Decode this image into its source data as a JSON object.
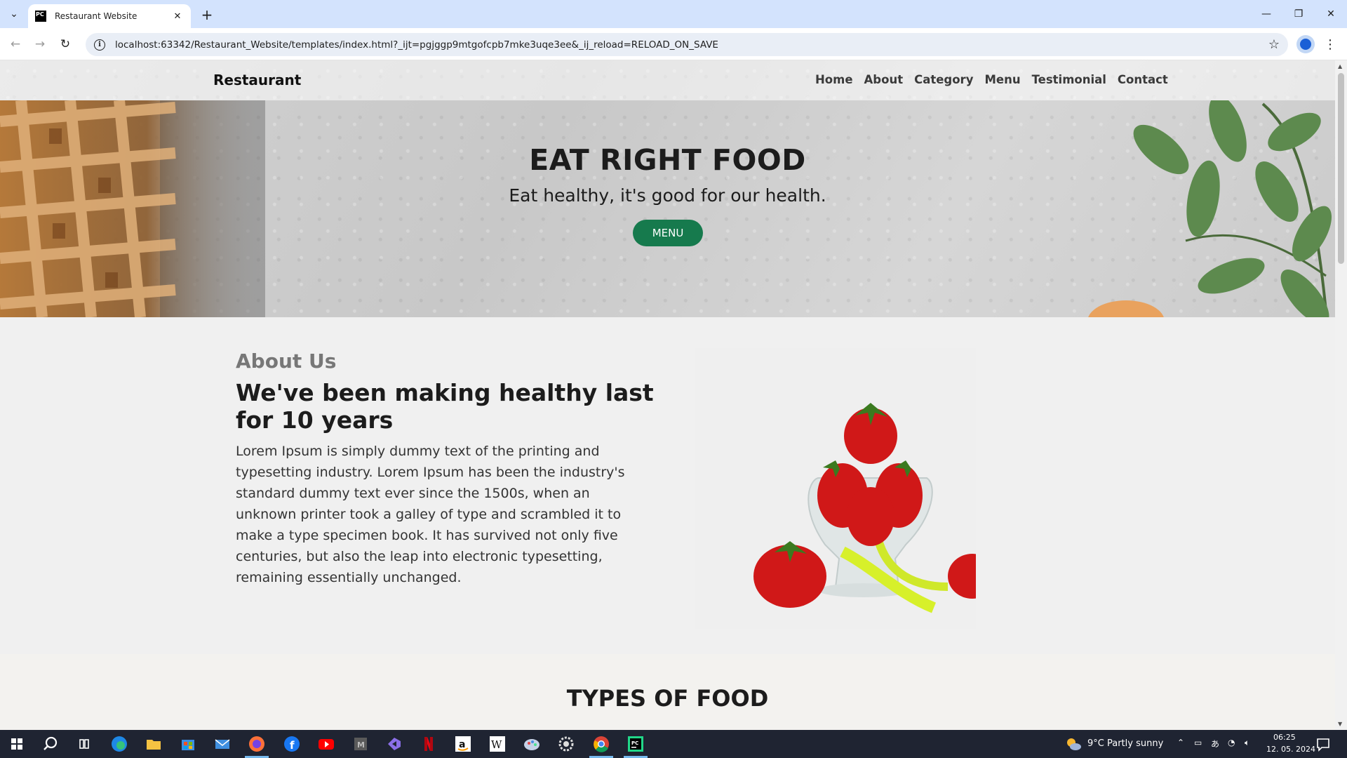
{
  "browser": {
    "tab_title": "Restaurant Website",
    "tab_favicon_text": "PC",
    "url": "localhost:63342/Restaurant_Website/templates/index.html?_ijt=pgjggp9mtgofcpb7mke3uqe3ee&_ij_reload=RELOAD_ON_SAVE"
  },
  "site": {
    "brand": "Restaurant",
    "nav": [
      "Home",
      "About",
      "Category",
      "Menu",
      "Testimonial",
      "Contact"
    ],
    "hero": {
      "title": "EAT RIGHT FOOD",
      "subtitle": "Eat healthy, it's good for our health.",
      "button": "MENU",
      "button_color": "#167a4d"
    },
    "about": {
      "eyebrow": "About Us",
      "title": "We've been making healthy last for 10 years",
      "text": "Lorem Ipsum is simply dummy text of the printing and typesetting industry. Lorem Ipsum has been the industry's standard dummy text ever since the 1500s, when an unknown printer took a galley of type and scrambled it to make a type specimen book. It has survived not only five centuries, but also the leap into electronic typesetting, remaining essentially unchanged."
    },
    "types_title": "TYPES OF FOOD"
  },
  "taskbar": {
    "weather": "9°C  Partly sunny",
    "time": "06:25",
    "date": "12. 05. 2024"
  }
}
